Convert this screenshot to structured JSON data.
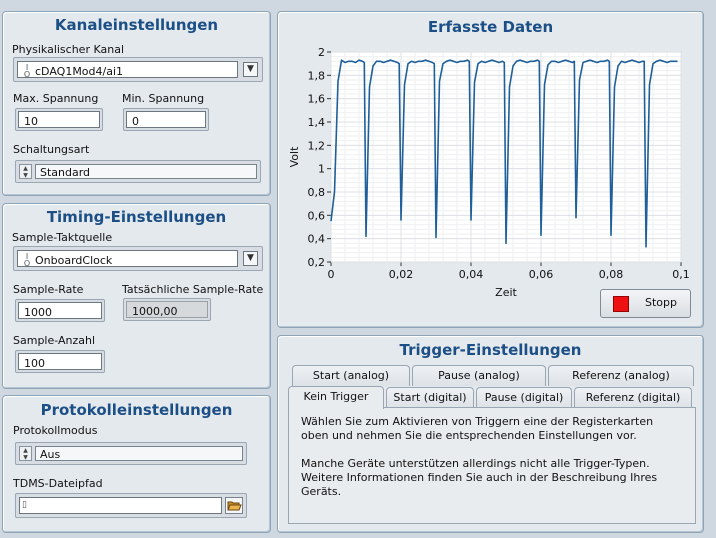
{
  "channel": {
    "title": "Kanaleinstellungen",
    "phys_label": "Physikalischer Kanal",
    "phys_value": "cDAQ1Mod4/ai1",
    "max_label": "Max. Spannung",
    "max_value": "10",
    "min_label": "Min. Spannung",
    "min_value": "0",
    "terminal_label": "Schaltungsart",
    "terminal_value": "Standard"
  },
  "timing": {
    "title": "Timing-Einstellungen",
    "clock_label": "Sample-Taktquelle",
    "clock_value": "OnboardClock",
    "rate_label": "Sample-Rate",
    "rate_value": "1000",
    "actual_label": "Tatsächliche Sample-Rate",
    "actual_value": "1000,00",
    "count_label": "Sample-Anzahl",
    "count_value": "100"
  },
  "logging": {
    "title": "Protokolleinstellungen",
    "mode_label": "Protokollmodus",
    "mode_value": "Aus",
    "path_label": "TDMS-Dateipfad",
    "path_value": ""
  },
  "graph": {
    "title": "Erfasste Daten",
    "stop_label": "Stopp"
  },
  "trigger": {
    "title": "Trigger-Einstellungen",
    "tabs_back": [
      "Start (analog)",
      "Pause (analog)",
      "Referenz (analog)"
    ],
    "tabs_front": [
      "Kein Trigger",
      "Start (digital)",
      "Pause (digital)",
      "Referenz (digital)"
    ],
    "text1": "Wählen Sie zum Aktivieren von Triggern eine der Registerkarten oben und nehmen Sie die entsprechenden Einstellungen vor.",
    "text2": "Manche Geräte unterstützen allerdings nicht alle Trigger-Typen. Weitere Informationen finden Sie auch in der Beschreibung Ihres Geräts."
  },
  "colors": {
    "title_blue": "#1c4f86",
    "plot_line": "#1f5f9a",
    "stop_led": "#ee1111"
  },
  "chart_data": {
    "type": "line",
    "xlabel": "Zeit",
    "ylabel": "Volt",
    "xlim": [
      0,
      0.1
    ],
    "ylim": [
      0.2,
      2
    ],
    "xticks": [
      "0",
      "0,02",
      "0,04",
      "0,06",
      "0,08",
      "0,1"
    ],
    "yticks": [
      "0,2",
      "0,4",
      "0,6",
      "0,8",
      "1",
      "1,2",
      "1,4",
      "1,6",
      "1,8",
      "2"
    ],
    "grid": true,
    "series": [
      {
        "x": [
          0.0,
          0.001,
          0.002,
          0.003,
          0.004,
          0.005,
          0.006,
          0.007,
          0.008,
          0.009,
          0.0095,
          0.01,
          0.011,
          0.012,
          0.013,
          0.014,
          0.015,
          0.016,
          0.017,
          0.018,
          0.019,
          0.0195,
          0.02,
          0.021,
          0.022,
          0.023,
          0.024,
          0.025,
          0.026,
          0.027,
          0.028,
          0.029,
          0.0295,
          0.03,
          0.031,
          0.032,
          0.033,
          0.034,
          0.035,
          0.036,
          0.037,
          0.038,
          0.039,
          0.0395,
          0.04,
          0.041,
          0.042,
          0.043,
          0.044,
          0.045,
          0.046,
          0.047,
          0.048,
          0.049,
          0.0495,
          0.05,
          0.051,
          0.052,
          0.053,
          0.054,
          0.055,
          0.056,
          0.057,
          0.058,
          0.059,
          0.0595,
          0.06,
          0.061,
          0.062,
          0.063,
          0.064,
          0.065,
          0.066,
          0.067,
          0.068,
          0.069,
          0.0695,
          0.07,
          0.071,
          0.072,
          0.073,
          0.074,
          0.075,
          0.076,
          0.077,
          0.078,
          0.079,
          0.0795,
          0.08,
          0.081,
          0.082,
          0.083,
          0.084,
          0.085,
          0.086,
          0.087,
          0.088,
          0.089,
          0.0895,
          0.09,
          0.091,
          0.092,
          0.093,
          0.094,
          0.095,
          0.096,
          0.097,
          0.098,
          0.099
        ],
        "y": [
          0.55,
          0.8,
          1.75,
          1.93,
          1.91,
          1.92,
          1.92,
          1.91,
          1.93,
          1.92,
          1.91,
          0.42,
          1.7,
          1.88,
          1.92,
          1.92,
          1.91,
          1.92,
          1.93,
          1.92,
          1.91,
          1.9,
          0.56,
          1.72,
          1.9,
          1.92,
          1.91,
          1.92,
          1.92,
          1.93,
          1.92,
          1.91,
          1.9,
          0.41,
          1.75,
          1.9,
          1.92,
          1.93,
          1.92,
          1.91,
          1.92,
          1.92,
          1.93,
          1.92,
          0.56,
          1.74,
          1.9,
          1.92,
          1.91,
          1.92,
          1.93,
          1.92,
          1.91,
          1.92,
          1.91,
          0.36,
          1.7,
          1.88,
          1.92,
          1.93,
          1.92,
          1.91,
          1.92,
          1.92,
          1.93,
          1.92,
          0.43,
          1.72,
          1.89,
          1.92,
          1.92,
          1.91,
          1.92,
          1.93,
          1.92,
          1.91,
          1.92,
          0.58,
          1.76,
          1.91,
          1.92,
          1.93,
          1.92,
          1.91,
          1.92,
          1.92,
          1.93,
          1.92,
          0.43,
          1.7,
          1.88,
          1.92,
          1.91,
          1.92,
          1.93,
          1.92,
          1.91,
          1.92,
          1.92,
          0.33,
          1.72,
          1.9,
          1.92,
          1.93,
          1.92,
          1.91,
          1.92,
          1.92,
          1.92
        ]
      }
    ]
  }
}
